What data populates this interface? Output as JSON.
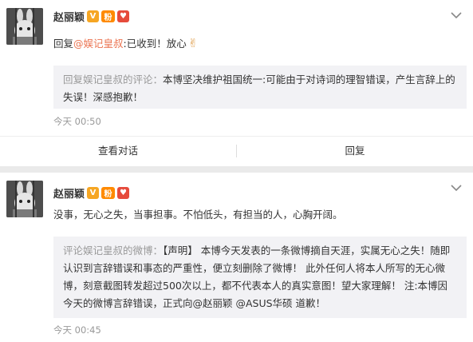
{
  "posts": [
    {
      "user": "赵丽颖",
      "reply_prefix": "回复",
      "reply_mention": "@娱记皇叔",
      "reply_text": ":已收到！放心",
      "emoji": "✌",
      "quote_label": "回复娱记皇叔的评论：",
      "quote_text": "本博坚决维护祖国统一:可能由于对诗词的理智错误，产生言辞上的失误！深感抱歉！",
      "time": "今天 00:50",
      "actions": {
        "view_conversation": "查看对话",
        "reply": "回复"
      }
    },
    {
      "user": "赵丽颖",
      "text": "没事，无心之失，当事担事。不怕低头，有担当的人，心胸开阔。",
      "quote_label": "评论娱记皇叔的微博：",
      "quote_text": "【声明】 本博今天发表的一条微博摘自天涯，实属无心之失！随即认识到言辞错误和事态的严重性，便立刻删除了微博！ 此外任何人将本人所写的无心微博，刻意截图转发超过500次以上，都不代表本人的真实意图！望大家理解！ 注:本博因今天的微博言辞错误，正式向@赵丽颖 @ASUS华硕 道歉！",
      "time": "今天 00:45"
    }
  ],
  "badges": {
    "v": "V",
    "fan": "粉",
    "heart": "♥"
  },
  "colors": {
    "mention": "#eb7350",
    "quote_bg": "#f2f2f5",
    "separator": "#eaeaea",
    "muted": "#999999"
  }
}
